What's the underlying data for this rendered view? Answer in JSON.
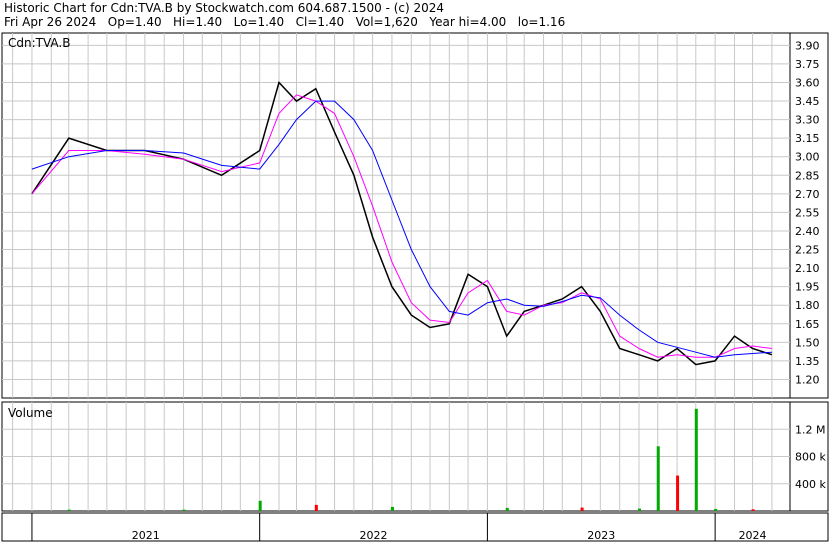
{
  "header": {
    "line1": "Historic Chart for Cdn:TVA.B by Stockwatch.com 604.687.1500 - (c) 2024",
    "line2": "Fri Apr 26 2024   Op=1.40   Hi=1.40   Lo=1.40   Cl=1.40   Vol=1,620   Year hi=4.00   lo=1.16"
  },
  "chart_data": [
    {
      "type": "line",
      "title": "Cdn:TVA.B",
      "y_ticks": [
        "3.90",
        "3.75",
        "3.60",
        "3.45",
        "3.30",
        "3.15",
        "3.00",
        "2.85",
        "2.70",
        "2.55",
        "2.40",
        "2.25",
        "2.10",
        "1.95",
        "1.80",
        "1.65",
        "1.50",
        "1.35",
        "1.20"
      ],
      "ylim": [
        1.05,
        4.0
      ],
      "grid": true,
      "x": [
        "2021-01",
        "2021-03",
        "2021-05",
        "2021-07",
        "2021-09",
        "2021-11",
        "2022-01",
        "2022-02",
        "2022-03",
        "2022-04",
        "2022-05",
        "2022-06",
        "2022-07",
        "2022-08",
        "2022-09",
        "2022-10",
        "2022-11",
        "2022-12",
        "2023-01",
        "2023-02",
        "2023-03",
        "2023-04",
        "2023-05",
        "2023-06",
        "2023-07",
        "2023-08",
        "2023-09",
        "2023-10",
        "2023-11",
        "2023-12",
        "2024-01",
        "2024-02",
        "2024-03",
        "2024-04"
      ],
      "series": [
        {
          "values": [
            2.7,
            3.15,
            3.05,
            3.05,
            2.98,
            2.85,
            3.05,
            3.6,
            3.45,
            3.55,
            3.2,
            2.85,
            2.35,
            1.95,
            1.72,
            1.62,
            1.65,
            2.05,
            1.95,
            1.55,
            1.75,
            1.8,
            1.85,
            1.95,
            1.75,
            1.45,
            1.4,
            1.35,
            1.45,
            1.32,
            1.35,
            1.55,
            1.45,
            1.4
          ],
          "color": "#000000"
        },
        {
          "values": [
            2.7,
            3.05,
            3.05,
            3.02,
            2.98,
            2.88,
            2.95,
            3.35,
            3.5,
            3.45,
            3.35,
            3.0,
            2.6,
            2.15,
            1.82,
            1.68,
            1.66,
            1.9,
            2.0,
            1.75,
            1.72,
            1.8,
            1.82,
            1.9,
            1.85,
            1.55,
            1.45,
            1.38,
            1.4,
            1.38,
            1.38,
            1.45,
            1.47,
            1.45
          ],
          "color": "#ff00ff"
        },
        {
          "values": [
            2.9,
            3.0,
            3.05,
            3.05,
            3.03,
            2.93,
            2.9,
            3.1,
            3.3,
            3.45,
            3.45,
            3.3,
            3.05,
            2.65,
            2.25,
            1.95,
            1.75,
            1.72,
            1.82,
            1.85,
            1.8,
            1.79,
            1.83,
            1.88,
            1.86,
            1.72,
            1.6,
            1.5,
            1.46,
            1.42,
            1.38,
            1.4,
            1.41,
            1.42
          ],
          "color": "#0000ff"
        }
      ]
    },
    {
      "type": "bar",
      "title": "Volume",
      "y_ticks": [
        "1.2 M",
        "800 k",
        "400 k"
      ],
      "ylim": [
        0,
        1600000
      ],
      "x": [
        "2021-03",
        "2021-09",
        "2022-01",
        "2022-04",
        "2022-08",
        "2023-02",
        "2023-06",
        "2023-09",
        "2023-10",
        "2023-11",
        "2023-12",
        "2024-01",
        "2024-03"
      ],
      "values": [
        20000,
        20000,
        150000,
        90000,
        60000,
        45000,
        50000,
        35000,
        950000,
        520000,
        1500000,
        30000,
        25000
      ],
      "colors": [
        "#00aa00",
        "#00aa00",
        "#00aa00",
        "#ff0000",
        "#00aa00",
        "#00aa00",
        "#ff0000",
        "#00aa00",
        "#00aa00",
        "#ff0000",
        "#00aa00",
        "#00aa00",
        "#ff0000"
      ]
    }
  ],
  "x_axis_labels": [
    "2021",
    "2022",
    "2023",
    "2024"
  ]
}
